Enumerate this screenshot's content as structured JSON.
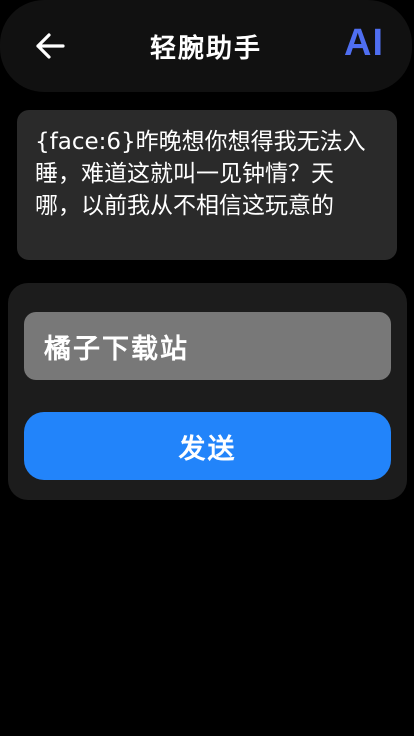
{
  "header": {
    "title": "轻腕助手",
    "ai_label": "AI",
    "back_icon": "arrow-left-icon"
  },
  "message": {
    "text": "{face:6}昨晚想你想得我无法入睡，难道这就叫一见钟情？天哪，以前我从不相信这玩意的"
  },
  "composer": {
    "input_value": "橘子下载站",
    "send_label": "发送"
  },
  "colors": {
    "accent": "#2284fa",
    "ai_brand": "#4f6ef0",
    "input_bg": "#787878",
    "card_bg": "#2a2a2a"
  }
}
